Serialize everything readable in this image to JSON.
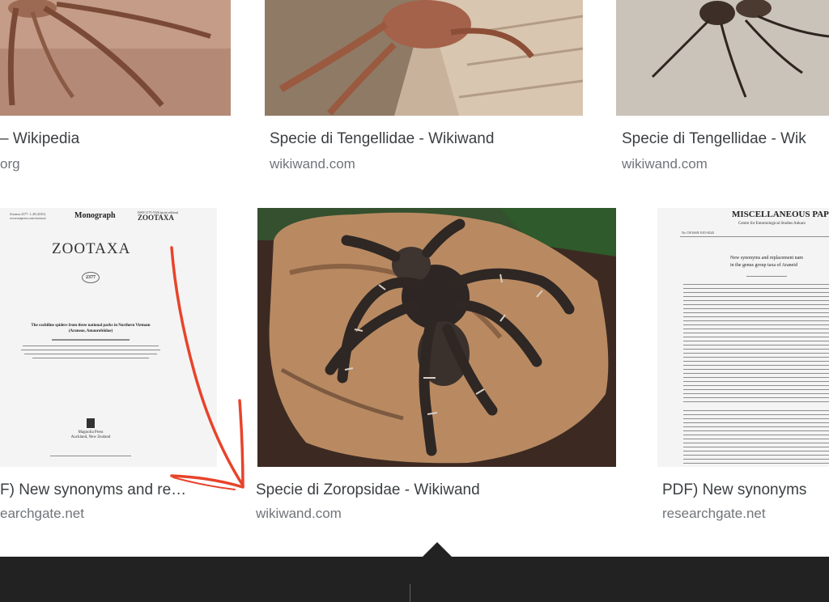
{
  "row1": [
    {
      "title": "– Wikipedia",
      "domain": "org"
    },
    {
      "title": "Specie di Tengellidae - Wikiwand",
      "domain": "wikiwand.com"
    },
    {
      "title": "Specie di Tengellidae - Wik",
      "domain": "wikiwand.com"
    }
  ],
  "row2": [
    {
      "title": "F) New synonyms and re…",
      "domain": "earchgate.net"
    },
    {
      "title": "Specie di Zoropsidae - Wikiwand",
      "domain": "wikiwand.com"
    },
    {
      "title": "PDF) New synonyms",
      "domain": "researchgate.net"
    }
  ],
  "zootaxa_doc": {
    "header_left_1": "Zootaxa 2377: 1–48 (2010)",
    "header_left_2": "www.mapress.com/zootaxa/",
    "header_mid": "Monograph",
    "header_right_1": "ISSN 1175-5326 (print edition)",
    "header_right_2": "ZOOTAXA",
    "title": "ZOOTAXA",
    "number": "2377",
    "paper_title": "The cochiline spiders from three national parks in Northern Vietnam",
    "paper_subtitle": "(Araneae, Amaurobiidae)",
    "publisher_1": "Magnolia Press",
    "publisher_2": "Auckland, New Zealand"
  },
  "misc_doc": {
    "header": "MISCELLANEOUS PAPE",
    "subheader": "Centre for Entomological Studies Ankara",
    "issue": "No 139   ISSN 1015-8243",
    "title_1": "New synonyms and replacement nam",
    "title_2": "in the genus group taxa of Araneid"
  },
  "colors": {
    "annotation": "#e8432a",
    "panel": "#222222",
    "title": "#3c4043",
    "domain": "#70757a"
  }
}
